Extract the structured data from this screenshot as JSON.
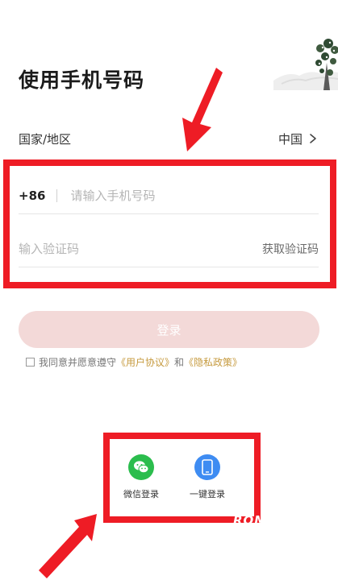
{
  "header": {
    "title": "使用手机号码"
  },
  "region": {
    "label": "国家/地区",
    "value": "中国"
  },
  "phone": {
    "country_code": "+86",
    "placeholder": "请输入手机号码"
  },
  "code": {
    "placeholder": "输入验证码",
    "get_code_label": "获取验证码"
  },
  "login": {
    "label": "登录"
  },
  "agreement": {
    "prefix": "我同意并愿意遵守",
    "user_agreement": "《用户协议》",
    "and": "和",
    "privacy_policy": "《隐私政策》",
    "checked": false
  },
  "social": {
    "wechat_label": "微信登录",
    "onekey_label": "一键登录"
  },
  "watermark": "ROM",
  "colors": {
    "annotation_red": "#ee1c25",
    "login_disabled": "#f3d9d8",
    "link": "#c69a3e",
    "wechat_green": "#2bbd4d",
    "onekey_blue": "#3e8cf2"
  }
}
